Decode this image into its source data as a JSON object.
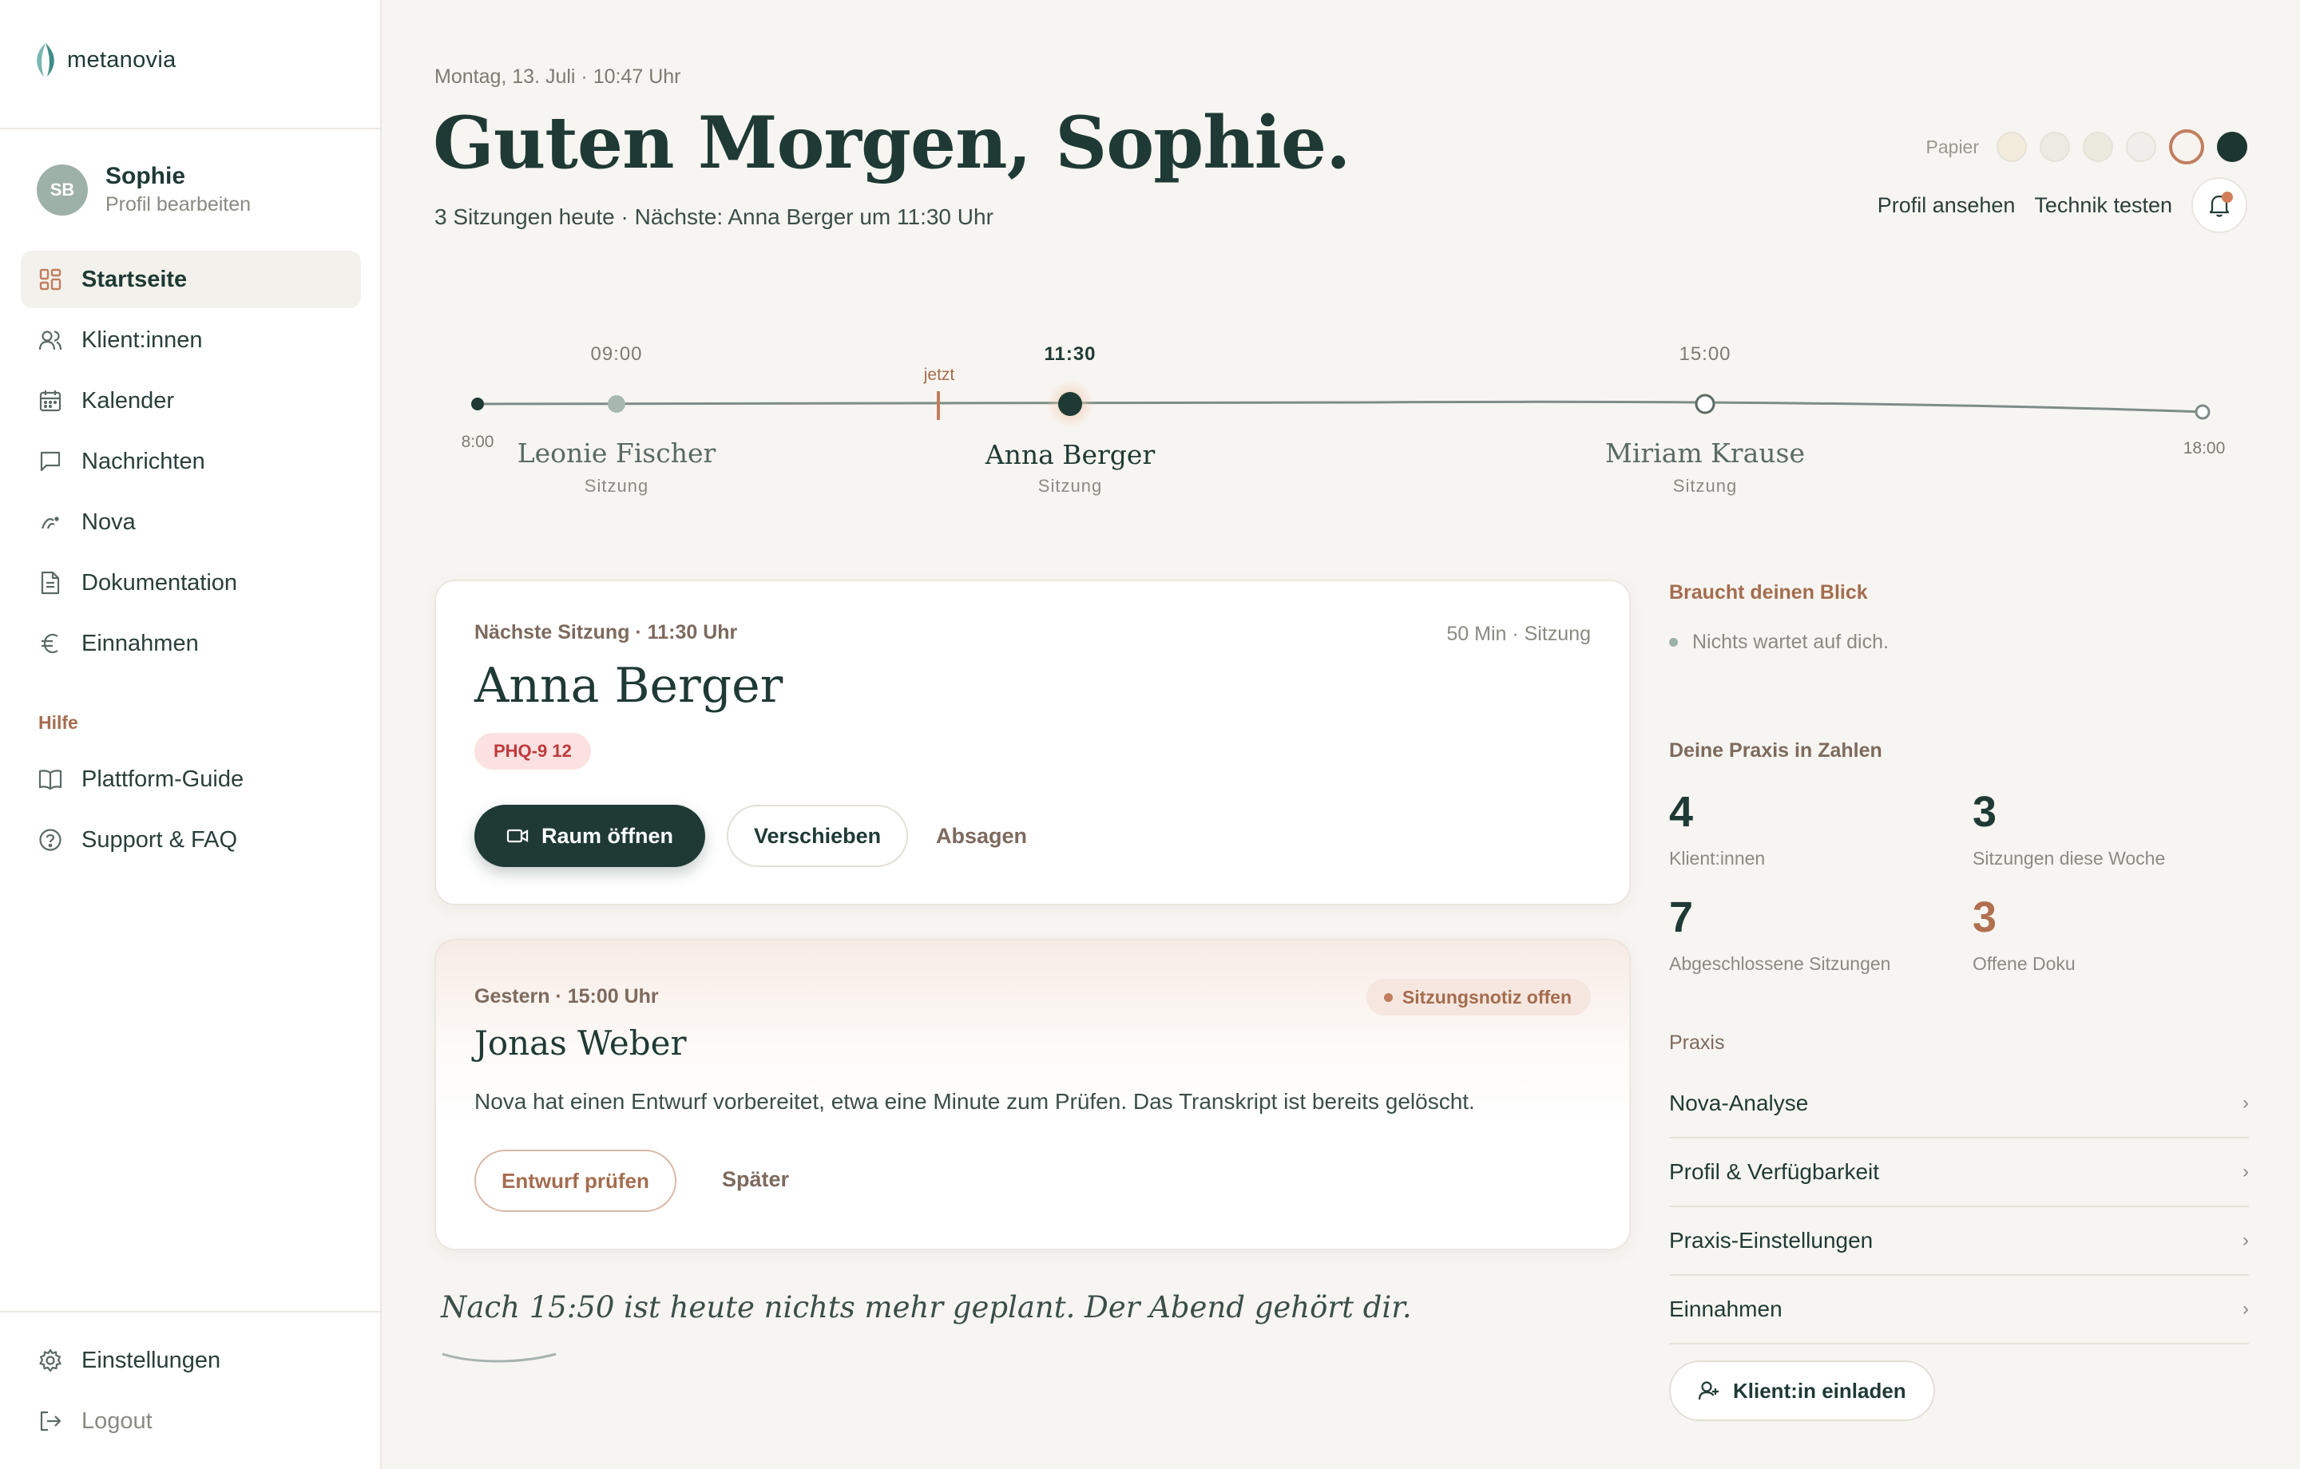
{
  "brand": {
    "name": "metanovia"
  },
  "user": {
    "initials": "SB",
    "name": "Sophie",
    "edit_label": "Profil bearbeiten"
  },
  "nav": {
    "items": [
      {
        "label": "Startseite"
      },
      {
        "label": "Klient:innen"
      },
      {
        "label": "Kalender"
      },
      {
        "label": "Nachrichten"
      },
      {
        "label": "Nova"
      },
      {
        "label": "Dokumentation"
      },
      {
        "label": "Einnahmen"
      }
    ],
    "help_title": "Hilfe",
    "help_items": [
      {
        "label": "Plattform-Guide"
      },
      {
        "label": "Support & FAQ"
      }
    ],
    "settings": "Einstellungen",
    "logout": "Logout"
  },
  "header": {
    "date": "Montag, 13. Juli · 10:47 Uhr",
    "greeting": "Guten Morgen, Sophie.",
    "summary": "3 Sitzungen heute · Nächste: Anna Berger um 11:30 Uhr",
    "paper_label": "Papier",
    "paper_swatches": [
      "#f3ebdc",
      "#eceae2",
      "#ebeade",
      "#efeeea",
      "#f7f3ee",
      "#1e3630"
    ],
    "profile_link": "Profil ansehen",
    "tech_link": "Technik testen"
  },
  "timeline": {
    "start": "8:00",
    "end": "18:00",
    "now_label": "jetzt",
    "sessions": [
      {
        "time": "09:00",
        "name": "Leonie Fischer",
        "type": "Sitzung"
      },
      {
        "time": "11:30",
        "name": "Anna Berger",
        "type": "Sitzung"
      },
      {
        "time": "15:00",
        "name": "Miriam Krause",
        "type": "Sitzung"
      }
    ]
  },
  "next_session": {
    "eyebrow": "Nächste Sitzung · 11:30 Uhr",
    "meta": "50 Min · Sitzung",
    "name": "Anna Berger",
    "badge": "PHQ-9 12",
    "open_room": "Raum öffnen",
    "reschedule": "Verschieben",
    "cancel": "Absagen"
  },
  "past_session": {
    "eyebrow": "Gestern · 15:00 Uhr",
    "status": "Sitzungsnotiz offen",
    "name": "Jonas Weber",
    "body": "Nova hat einen Entwurf vorbereitet, etwa eine Minute zum Prüfen. Das Transkript ist bereits gelöscht.",
    "review": "Entwurf prüfen",
    "later": "Später"
  },
  "closing": "Nach 15:50 ist heute nichts mehr geplant. Der Abend gehört dir.",
  "attention": {
    "title": "Braucht deinen Blick",
    "empty": "Nichts wartet auf dich."
  },
  "stats": {
    "title": "Deine Praxis in Zahlen",
    "items": [
      {
        "value": "4",
        "label": "Klient:innen"
      },
      {
        "value": "3",
        "label": "Sitzungen diese Woche"
      },
      {
        "value": "7",
        "label": "Abgeschlossene Sitzungen"
      },
      {
        "value": "3",
        "label": "Offene Doku"
      }
    ]
  },
  "praxis": {
    "title": "Praxis",
    "items": [
      {
        "label": "Nova-Analyse"
      },
      {
        "label": "Profil & Verfügbarkeit"
      },
      {
        "label": "Praxis-Einstellungen"
      },
      {
        "label": "Einnahmen"
      }
    ],
    "invite": "Klient:in einladen"
  }
}
